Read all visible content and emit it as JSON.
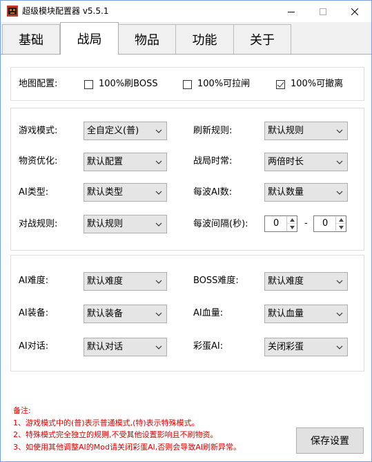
{
  "window": {
    "title": "超级模块配置器 v5.5.1"
  },
  "tabs": [
    {
      "label": "基础",
      "active": false
    },
    {
      "label": "战局",
      "active": true
    },
    {
      "label": "物品",
      "active": false
    },
    {
      "label": "功能",
      "active": false
    },
    {
      "label": "关于",
      "active": false
    }
  ],
  "map_config": {
    "label": "地图配置:",
    "options": [
      {
        "label": "100%刷BOSS",
        "checked": false
      },
      {
        "label": "100%可拉闸",
        "checked": false
      },
      {
        "label": "100%可撤离",
        "checked": true
      }
    ]
  },
  "game_settings": {
    "game_mode": {
      "label": "游戏模式:",
      "value": "全自定义(普)"
    },
    "refresh_rule": {
      "label": "刷新规则:",
      "value": "默认规则"
    },
    "supply_opt": {
      "label": "物资优化:",
      "value": "默认配置"
    },
    "match_time": {
      "label": "战局时常:",
      "value": "两倍时长"
    },
    "ai_type": {
      "label": "AI类型:",
      "value": "默认类型"
    },
    "ai_per_wave": {
      "label": "每波AI数:",
      "value": "默认数量"
    },
    "battle_rule": {
      "label": "对战规则:",
      "value": "默认规则"
    },
    "wave_interval": {
      "label": "每波间隔(秒):",
      "min": "0",
      "max": "0",
      "separator": "-"
    }
  },
  "ai_settings": {
    "ai_difficulty": {
      "label": "AI难度:",
      "value": "默认难度"
    },
    "boss_difficulty": {
      "label": "BOSS难度:",
      "value": "默认难度"
    },
    "ai_gear": {
      "label": "AI装备:",
      "value": "默认装备"
    },
    "ai_hp": {
      "label": "AI血量:",
      "value": "默认血量"
    },
    "ai_dialog": {
      "label": "AI对话:",
      "value": "默认对话"
    },
    "easter_ai": {
      "label": "彩蛋AI:",
      "value": "关闭彩蛋"
    }
  },
  "notes": {
    "title": "备注:",
    "lines": [
      "1、游戏模式中的(普)表示普通模式,(特)表示特殊模式。",
      "2、特殊模式完全独立的规则,不受其他设置影响且不刷物资。",
      "3、如使用其他调整AI的Mod请关闭彩蛋AI,否则会导致AI刷新异常。"
    ]
  },
  "save_button": {
    "label": "保存设置"
  }
}
